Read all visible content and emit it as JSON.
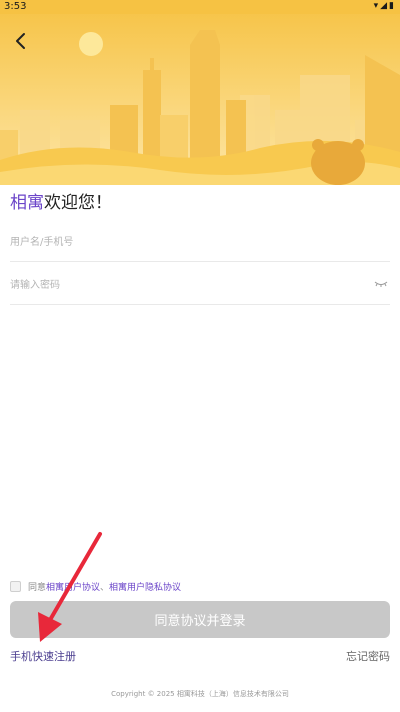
{
  "status_bar": {
    "time": "3:53",
    "icons": [
      "wifi-icon",
      "signal-icon",
      "battery-icon"
    ]
  },
  "header": {
    "back_icon": "chevron-left-icon"
  },
  "welcome": {
    "brand": "相寓",
    "text": "欢迎您！"
  },
  "form": {
    "username_placeholder": "用户名/手机号",
    "password_placeholder": "请输入密码",
    "password_toggle_icon": "eye-closed-icon"
  },
  "agreement": {
    "prefix": "同意",
    "user_agreement": "相寓用户协议",
    "separator": "、",
    "privacy_policy": "相寓用户隐私协议",
    "checked": false
  },
  "actions": {
    "login_label": "同意协议并登录",
    "register_label": "手机快速注册",
    "forgot_label": "忘记密码"
  },
  "footer": {
    "copyright": "Copyright © 2025 相寓科技（上海）信息技术有限公司"
  },
  "colors": {
    "brand_purple": "#6b45c9",
    "hero_yellow": "#f6c243",
    "button_disabled": "#c8c8c8",
    "arrow_red": "#e8283a"
  }
}
